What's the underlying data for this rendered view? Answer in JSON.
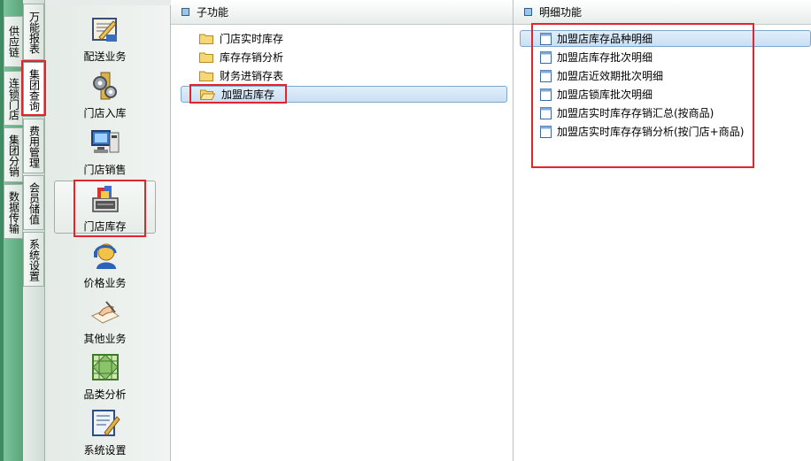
{
  "vertical_tabs_outer": [
    {
      "label": "供应链"
    },
    {
      "label": "连锁门店"
    },
    {
      "label": "集团分销"
    },
    {
      "label": "数据传输"
    }
  ],
  "vertical_tabs_inner": [
    {
      "label": "万能报表"
    },
    {
      "label": "集团查询"
    },
    {
      "label": "费用管理"
    },
    {
      "label": "会员储值"
    },
    {
      "label": "系统设置"
    }
  ],
  "modules": [
    {
      "label": "配送业务",
      "icon": "delivery-icon"
    },
    {
      "label": "门店入库",
      "icon": "gear-tower-icon"
    },
    {
      "label": "门店销售",
      "icon": "pos-computer-icon"
    },
    {
      "label": "门店库存",
      "icon": "inventory-register-icon"
    },
    {
      "label": "价格业务",
      "icon": "person-headset-icon"
    },
    {
      "label": "其他业务",
      "icon": "hand-writing-icon"
    },
    {
      "label": "品类分析",
      "icon": "grid-analysis-icon"
    },
    {
      "label": "系统设置",
      "icon": "settings-doc-icon"
    }
  ],
  "sub_panel": {
    "title": "子功能",
    "items": [
      {
        "label": "门店实时库存"
      },
      {
        "label": "库存存销分析"
      },
      {
        "label": "财务进销存表"
      },
      {
        "label": "加盟店库存"
      }
    ]
  },
  "detail_panel": {
    "title": "明细功能",
    "items": [
      {
        "label": "加盟店库存品种明细"
      },
      {
        "label": "加盟店库存批次明细"
      },
      {
        "label": "加盟店近效期批次明细"
      },
      {
        "label": "加盟店锁库批次明细"
      },
      {
        "label": "加盟店实时库存存销汇总(按商品)"
      },
      {
        "label": "加盟店实时库存存销分析(按门店+商品)"
      }
    ]
  },
  "colors": {
    "background": "#5aa57a",
    "selection": "#c9dff3",
    "highlight_box": "#e3242b",
    "folder": "#f2c94c"
  }
}
